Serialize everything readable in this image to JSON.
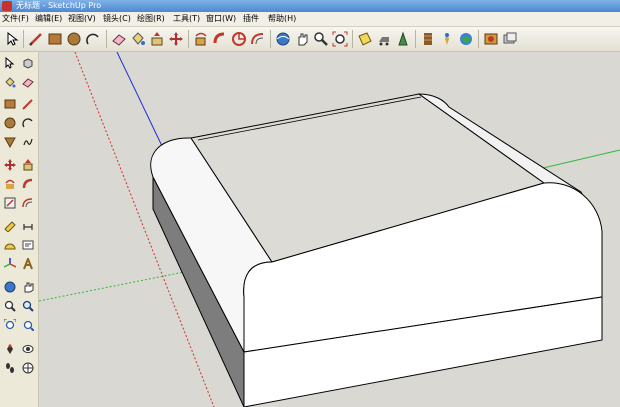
{
  "window": {
    "title": "无标题 - SketchUp Pro"
  },
  "menu": {
    "items": [
      {
        "label": "文件(F)"
      },
      {
        "label": "编辑(E)"
      },
      {
        "label": "视图(V)"
      },
      {
        "label": "镜头(C)"
      },
      {
        "label": "绘图(R)"
      },
      {
        "label": "工具(T)"
      },
      {
        "label": "窗口(W)"
      },
      {
        "label": "插件"
      },
      {
        "label": "帮助(H)"
      }
    ]
  },
  "toolbar": {
    "tools": [
      "select-icon",
      "pencil-icon",
      "rectangle-icon",
      "circle-icon",
      "arc-icon",
      "eraser-icon",
      "paint-bucket-icon",
      "push-pull-icon",
      "move-icon",
      "rotate-icon",
      "follow-me-icon",
      "orbit-icon",
      "pan-icon",
      "zoom-icon",
      "zoom-extents-icon",
      "section-plane-icon",
      "walk-icon",
      "position-camera-icon",
      "look-around-icon",
      "components-icon",
      "materials-icon",
      "styles-icon"
    ]
  },
  "left_toolbar": {
    "tools": [
      "select-icon",
      "make-component-icon",
      "paint-bucket-icon",
      "eraser-icon",
      "rectangle-icon",
      "line-icon",
      "circle-icon",
      "arc-icon",
      "polygon-icon",
      "freehand-icon",
      "move-icon",
      "push-pull-icon",
      "rotate-icon",
      "follow-me-icon",
      "scale-icon",
      "offset-icon",
      "tape-measure-icon",
      "dimension-icon",
      "protractor-icon",
      "text-icon",
      "axes-icon",
      "3d-text-icon",
      "orbit-icon",
      "pan-icon",
      "zoom-icon",
      "zoom-window-icon",
      "zoom-extents-icon",
      "previous-view-icon",
      "position-camera-icon",
      "look-around-icon",
      "walk-icon",
      "section-plane-icon"
    ]
  },
  "colors": {
    "viewport_bg": "#d9d8d2",
    "axis_blue": "#1c2bd6",
    "axis_green": "#2fb93a",
    "axis_red": "#d23030",
    "model_top": "#dcdbd6",
    "model_side": "#ffffff",
    "model_edge": "#000000"
  }
}
